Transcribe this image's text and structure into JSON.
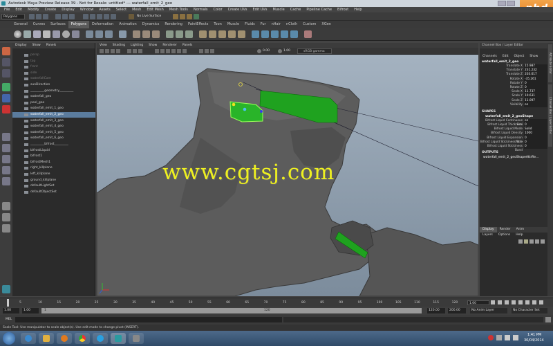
{
  "window": {
    "title": "Autodesk Maya Preview Release 39 - Not for Resale: untitled* --- waterfall_emit_2_geo"
  },
  "menubar": [
    "File",
    "Edit",
    "Modify",
    "Create",
    "Display",
    "Window",
    "Assets",
    "Select",
    "Mesh",
    "Edit Mesh",
    "Mesh Tools",
    "Normals",
    "Color",
    "Create UVs",
    "Edit UVs",
    "Muscle",
    "Cache",
    "Pipeline Cache",
    "Bifrost",
    "Help"
  ],
  "statusline": {
    "mode": "Polygons",
    "live": "No Live Surface"
  },
  "shelf_tabs": [
    {
      "label": "General"
    },
    {
      "label": "Curves"
    },
    {
      "label": "Surfaces"
    },
    {
      "label": "Polygons",
      "active": true
    },
    {
      "label": "Deformation"
    },
    {
      "label": "Animation"
    },
    {
      "label": "Dynamics"
    },
    {
      "label": "Rendering"
    },
    {
      "label": "PaintEffects"
    },
    {
      "label": "Toon"
    },
    {
      "label": "Muscle"
    },
    {
      "label": "Fluids"
    },
    {
      "label": "Fur"
    },
    {
      "label": "nHair"
    },
    {
      "label": "nCloth"
    },
    {
      "label": "Custom"
    },
    {
      "label": "XGen"
    }
  ],
  "outliner": {
    "menu": [
      "Display",
      "Show",
      "Panels"
    ],
    "items": [
      {
        "label": "persp",
        "dim": true
      },
      {
        "label": "top",
        "dim": true
      },
      {
        "label": "front",
        "dim": true
      },
      {
        "label": "side",
        "dim": true
      },
      {
        "label": "waterfallCam",
        "dim": true
      },
      {
        "label": "sunDirection"
      },
      {
        "label": "_________geometry_________"
      },
      {
        "label": "waterfall_geo"
      },
      {
        "label": "pool_geo"
      },
      {
        "label": "waterfall_emit_1_geo"
      },
      {
        "label": "waterfall_emit_2_geo",
        "selected": true
      },
      {
        "label": "waterfall_emit_3_geo"
      },
      {
        "label": "waterfall_emit_4_geo"
      },
      {
        "label": "waterfall_emit_5_geo"
      },
      {
        "label": "waterfall_emit_6_geo"
      },
      {
        "label": "_________bifrost_________"
      },
      {
        "label": "bifrostLiquid"
      },
      {
        "label": "bifrost1"
      },
      {
        "label": "bifrostMesh1"
      },
      {
        "label": "right_killplane"
      },
      {
        "label": "left_killplane"
      },
      {
        "label": "ground_killplane"
      },
      {
        "label": "defaultLightSet"
      },
      {
        "label": "defaultObjectSet"
      }
    ]
  },
  "viewport": {
    "menu": [
      "View",
      "Shading",
      "Lighting",
      "Show",
      "Renderer",
      "Panels"
    ],
    "field1": "0.00",
    "field2": "1.00",
    "gamma": "sRGB gamma",
    "watermark": "www.cgtsj.com"
  },
  "channel_box": {
    "tab_label": "Channel Box / Layer Editor",
    "menu": [
      "Channels",
      "Edit",
      "Object",
      "Show"
    ],
    "object_name": "waterfall_emit_2_geo",
    "attributes": [
      {
        "name": "Translate X",
        "value": "15.987"
      },
      {
        "name": "Translate Y",
        "value": "231.232"
      },
      {
        "name": "Translate Z",
        "value": "203.617"
      },
      {
        "name": "Rotate X",
        "value": "-35.261"
      },
      {
        "name": "Rotate Y",
        "value": "0"
      },
      {
        "name": "Rotate Z",
        "value": "0"
      },
      {
        "name": "Scale X",
        "value": "11.737"
      },
      {
        "name": "Scale Y",
        "value": "10.631"
      },
      {
        "name": "Scale Z",
        "value": "11.097"
      },
      {
        "name": "Visibility",
        "value": "on"
      }
    ],
    "shapes_label": "SHAPES",
    "shape_name": "waterfall_emit_2_geoShape",
    "shape_attributes": [
      {
        "name": "Bifrost Liquid Continuous Emi",
        "value": "on"
      },
      {
        "name": "Bifrost Liquid Thickness",
        "value": "0"
      },
      {
        "name": "Bifrost Liquid Mode",
        "value": "Solid"
      },
      {
        "name": "Bifrost Liquid Density",
        "value": "1000"
      },
      {
        "name": "Bifrost Liquid Expansion Rate",
        "value": "0"
      },
      {
        "name": "Bifrost Liquid Stickiness Stre",
        "value": "0"
      },
      {
        "name": "Bifrost Liquid Stickiness Band",
        "value": "0"
      }
    ],
    "outputs_label": "OUTPUTS",
    "output_name": "waterfall_emit_2_geoShapeAttrRe..."
  },
  "layer_editor": {
    "tabs": [
      {
        "label": "Display",
        "active": true
      },
      {
        "label": "Render"
      },
      {
        "label": "Anim"
      }
    ],
    "menu": [
      "Layers",
      "Options",
      "Help"
    ]
  },
  "side_tabs": [
    "Attribute Editor",
    "Channel Box / Layer Editor"
  ],
  "timeline": {
    "ticks": [
      "5",
      "10",
      "15",
      "20",
      "25",
      "30",
      "35",
      "40",
      "45",
      "50",
      "55",
      "60",
      "65",
      "70",
      "75",
      "80",
      "85",
      "90",
      "95",
      "100",
      "105",
      "110",
      "115",
      "120"
    ],
    "current": "1.00",
    "range_start": "1.00",
    "range_inner_start": "1.00",
    "range_inner_value": "1",
    "range_inner_end": "120",
    "range_end": "120.00",
    "range_max": "200.00",
    "anim_layer": "No Anim Layer",
    "char_set": "No Character Set"
  },
  "command_line": {
    "label": "MEL"
  },
  "help_line": "Scale Tool: Use manipulator to scale object(s). Use edit mode to change pivot (INSERT).",
  "taskbar": {
    "time": "1:41 PM",
    "date": "30/04/2014"
  },
  "corner_logo": "phd"
}
